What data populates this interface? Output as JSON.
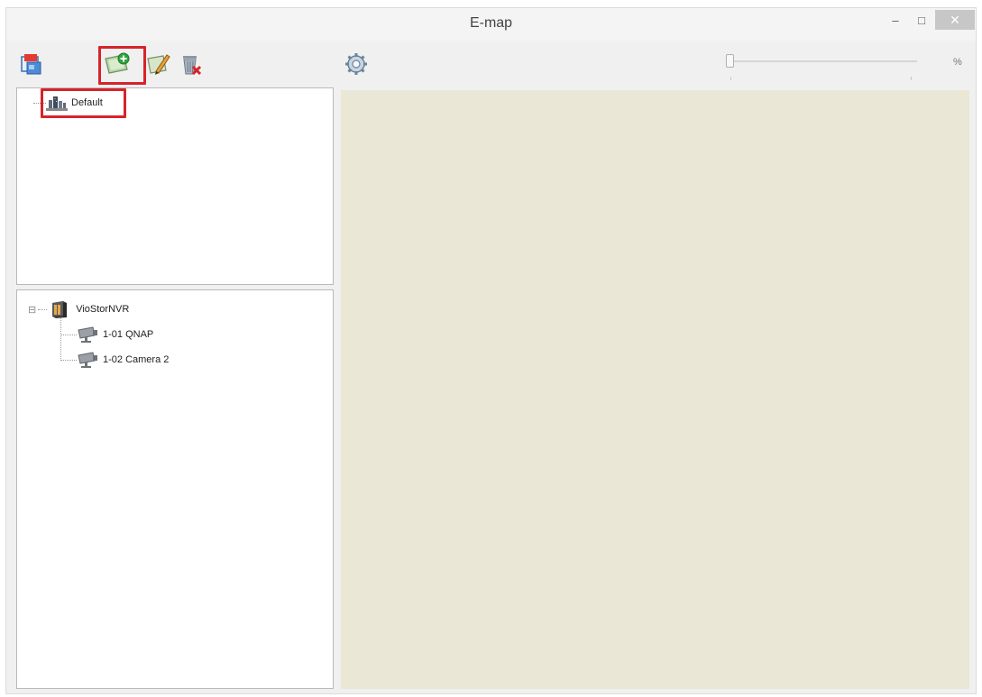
{
  "window": {
    "title": "E-map",
    "minimize_glyph": "–",
    "maximize_glyph": "□",
    "close_glyph": "✕"
  },
  "toolbar": {
    "icons": [
      "emap-settings-icon",
      "add-map-icon",
      "edit-map-icon",
      "delete-map-icon",
      "gear-icon"
    ],
    "zoom_unit": "%"
  },
  "map_tree": {
    "items": [
      {
        "label": "Default",
        "icon": "building-map-icon"
      }
    ]
  },
  "device_tree": {
    "root": {
      "label": "VioStorNVR",
      "icon": "nvr-server-icon",
      "expander": "⊟"
    },
    "cameras": [
      {
        "label": "1-01 QNAP",
        "icon": "camera-icon"
      },
      {
        "label": "1-02 Camera 2",
        "icon": "camera-icon"
      }
    ]
  },
  "colors": {
    "highlight": "#d8232a",
    "map_background": "#eae7d6",
    "window_background": "#f0f0f0"
  }
}
